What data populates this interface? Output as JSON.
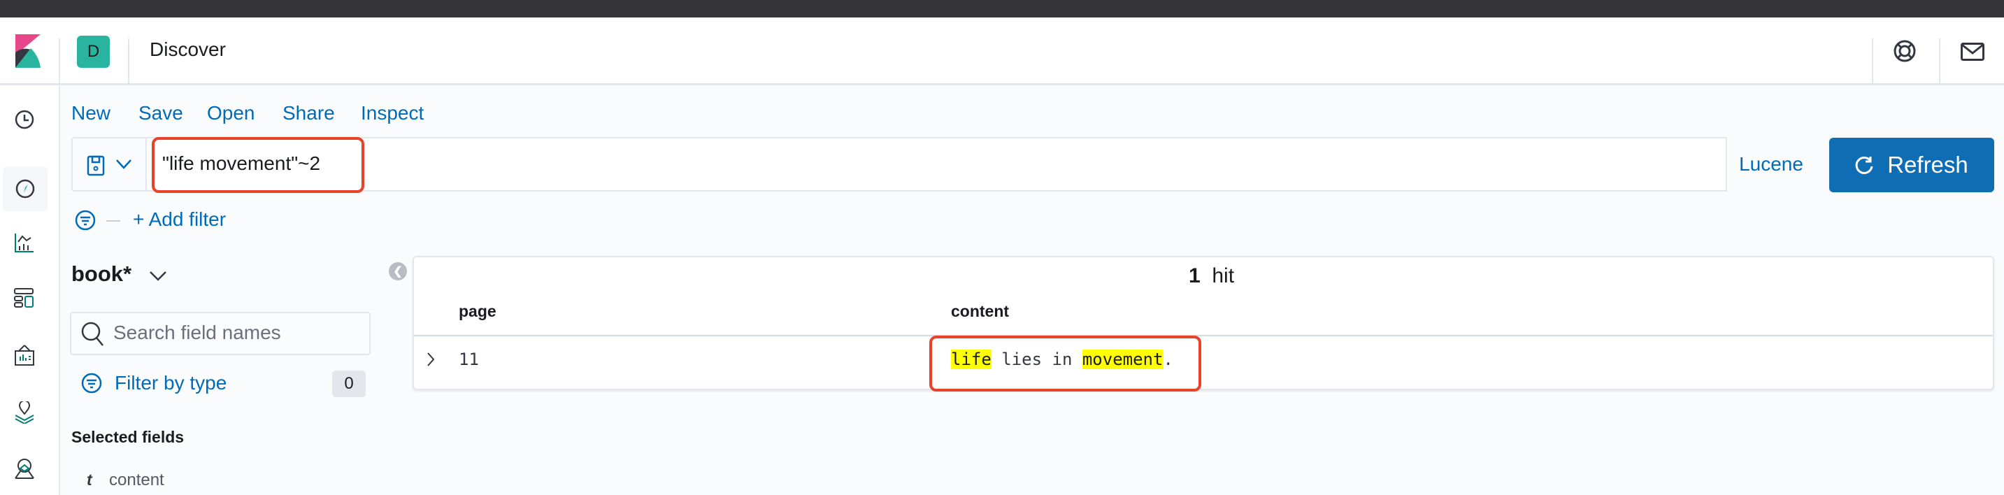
{
  "header": {
    "space_initial": "D",
    "app_title": "Discover",
    "help_icon": "lifebuoy-icon",
    "news_icon": "mail-icon"
  },
  "top_menu": {
    "new": "New",
    "save": "Save",
    "open": "Open",
    "share": "Share",
    "inspect": "Inspect"
  },
  "query": {
    "value": "\"life movement\"~2",
    "language": "Lucene",
    "refresh": "Refresh"
  },
  "filter": {
    "add": "+ Add filter"
  },
  "sidebar_fields": {
    "index_pattern": "book*",
    "search_placeholder": "Search field names",
    "filter_by_type": "Filter by type",
    "filter_count": "0",
    "selected_heading": "Selected fields",
    "selected": [
      {
        "type": "t",
        "name": "content"
      }
    ]
  },
  "results": {
    "hit_count": "1",
    "hit_label": "hit",
    "columns": [
      "page",
      "content"
    ],
    "rows": [
      {
        "page": "11",
        "content_parts": [
          {
            "text": "life",
            "highlight": true
          },
          {
            "text": " lies in ",
            "highlight": false
          },
          {
            "text": "movement",
            "highlight": true
          },
          {
            "text": ".",
            "highlight": false
          }
        ]
      }
    ]
  },
  "colors": {
    "accent": "#006bb8",
    "button": "#0f6db3",
    "highlight": "#ffff00",
    "annotation": "#e8422b"
  }
}
